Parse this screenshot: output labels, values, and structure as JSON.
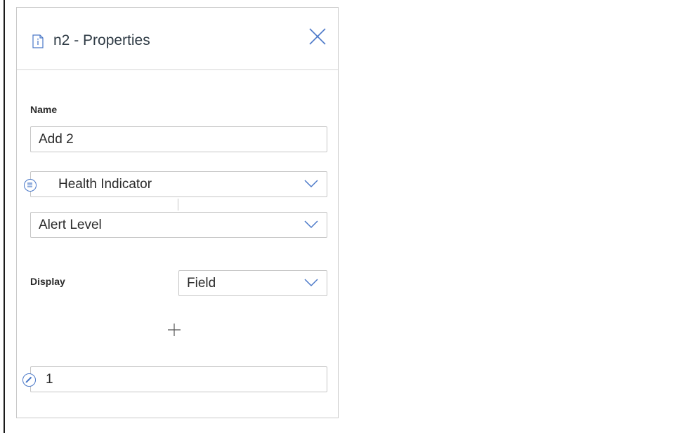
{
  "panel": {
    "title": "n2 - Properties",
    "icon": "document-info-icon",
    "close_icon": "close-icon"
  },
  "name_section": {
    "label": "Name",
    "value": "Add 2"
  },
  "field_selector": {
    "primary": "Health Indicator",
    "secondary": "Alert Level",
    "icon": "list-icon"
  },
  "display_section": {
    "label": "Display",
    "value": "Field"
  },
  "add_icon": "plus-icon",
  "value_field": {
    "value": "1",
    "icon": "edit-pencil-icon"
  },
  "colors": {
    "accent": "#4a78c8",
    "border": "#c6c6c6",
    "text": "#2b2b2b"
  }
}
